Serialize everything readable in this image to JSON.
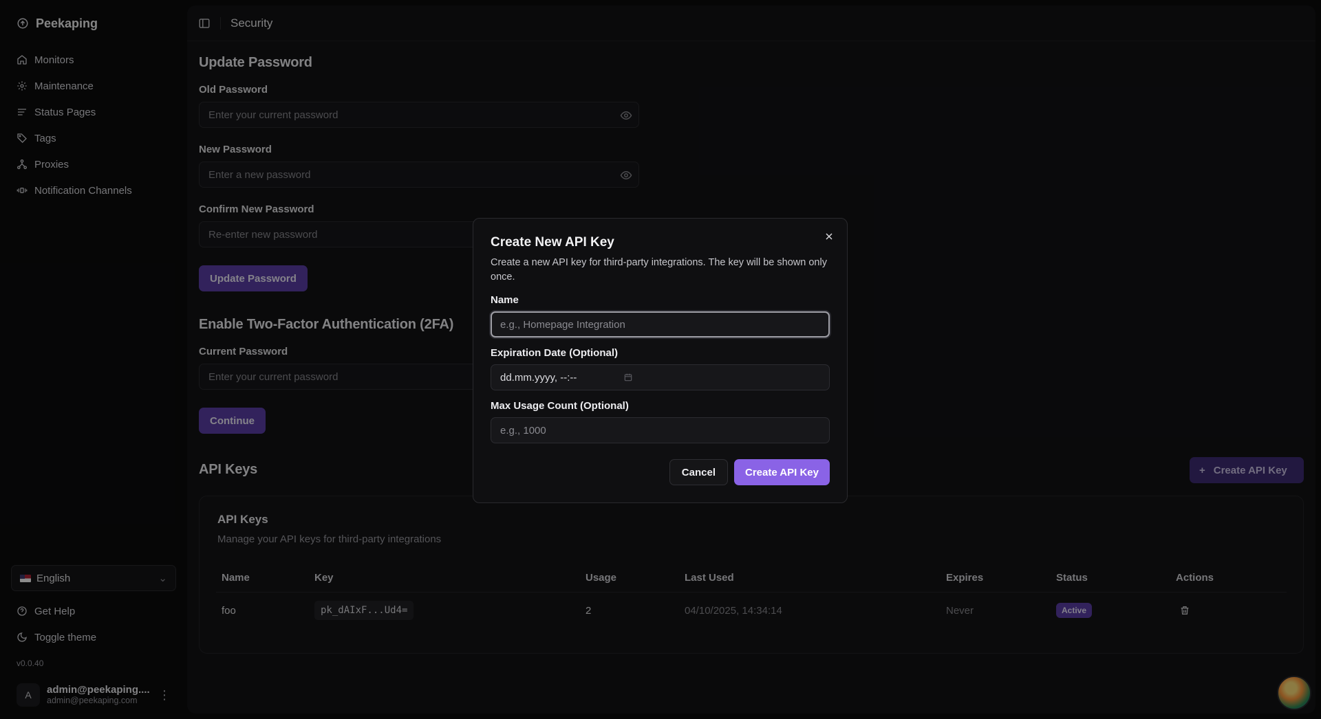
{
  "app": {
    "name": "Peekaping",
    "version": "v0.0.40"
  },
  "sidebar": {
    "items": [
      {
        "label": "Monitors",
        "icon": "home-icon"
      },
      {
        "label": "Maintenance",
        "icon": "gear-icon"
      },
      {
        "label": "Status Pages",
        "icon": "list-icon"
      },
      {
        "label": "Tags",
        "icon": "tag-icon"
      },
      {
        "label": "Proxies",
        "icon": "network-icon"
      },
      {
        "label": "Notification Channels",
        "icon": "broadcast-icon"
      }
    ],
    "language": "English",
    "get_help": "Get Help",
    "toggle_theme": "Toggle theme",
    "user": {
      "initial": "A",
      "name": "admin@peekaping....",
      "email": "admin@peekaping.com"
    }
  },
  "header": {
    "title": "Security"
  },
  "password": {
    "heading": "Update Password",
    "old_label": "Old Password",
    "old_placeholder": "Enter your current password",
    "new_label": "New Password",
    "new_placeholder": "Enter a new password",
    "confirm_label": "Confirm New Password",
    "confirm_placeholder": "Re-enter new password",
    "submit": "Update Password"
  },
  "twofa": {
    "heading": "Enable Two-Factor Authentication (2FA)",
    "current_label": "Current Password",
    "current_placeholder": "Enter your current password",
    "submit": "Continue"
  },
  "api": {
    "heading": "API Keys",
    "create_button": "Create API Key",
    "card_title": "API Keys",
    "card_subtitle": "Manage your API keys for third-party integrations",
    "columns": [
      "Name",
      "Key",
      "Usage",
      "Last Used",
      "Expires",
      "Status",
      "Actions"
    ],
    "rows": [
      {
        "name": "foo",
        "key": "pk_dAIxF...Ud4=",
        "usage": "2",
        "last_used": "04/10/2025, 14:34:14",
        "expires": "Never",
        "status": "Active"
      }
    ]
  },
  "modal": {
    "title": "Create New API Key",
    "description": "Create a new API key for third-party integrations. The key will be shown only once.",
    "name_label": "Name",
    "name_placeholder": "e.g., Homepage Integration",
    "expiration_label": "Expiration Date (Optional)",
    "expiration_value": "dd.mm.yyyy, --:--",
    "max_usage_label": "Max Usage Count (Optional)",
    "max_usage_placeholder": "e.g., 1000",
    "cancel": "Cancel",
    "confirm": "Create API Key"
  },
  "colors": {
    "accent": "#8a63e6",
    "accent_dim": "#5b3fa8",
    "background": "#0b0b0c",
    "panel": "#131315"
  }
}
